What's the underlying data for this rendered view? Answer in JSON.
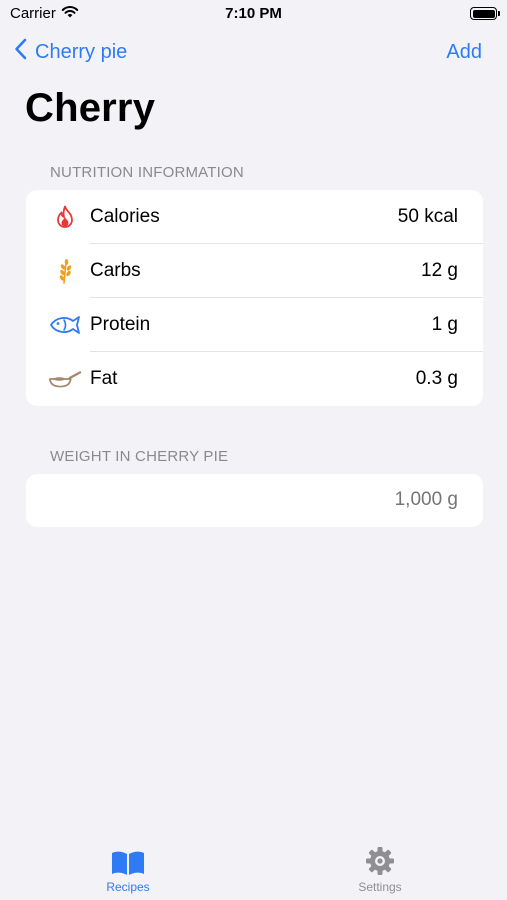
{
  "status_bar": {
    "carrier": "Carrier",
    "time": "7:10 PM"
  },
  "nav": {
    "back_label": "Cherry pie",
    "add_label": "Add"
  },
  "title": "Cherry",
  "nutrition": {
    "header": "NUTRITION INFORMATION",
    "rows": [
      {
        "label": "Calories",
        "value": "50 kcal",
        "icon": "flame-icon",
        "color": "#e53935"
      },
      {
        "label": "Carbs",
        "value": "12 g",
        "icon": "wheat-icon",
        "color": "#f0a020"
      },
      {
        "label": "Protein",
        "value": "1 g",
        "icon": "fish-icon",
        "color": "#2f7bf5"
      },
      {
        "label": "Fat",
        "value": "0.3 g",
        "icon": "pan-icon",
        "color": "#a5876a"
      }
    ]
  },
  "weight": {
    "header": "WEIGHT IN CHERRY PIE",
    "placeholder": "1,000 g"
  },
  "tabs": {
    "recipes_label": "Recipes",
    "settings_label": "Settings"
  },
  "colors": {
    "accent": "#2f7bf5",
    "background": "#f2f2f7",
    "inactive": "#8e8e93"
  }
}
